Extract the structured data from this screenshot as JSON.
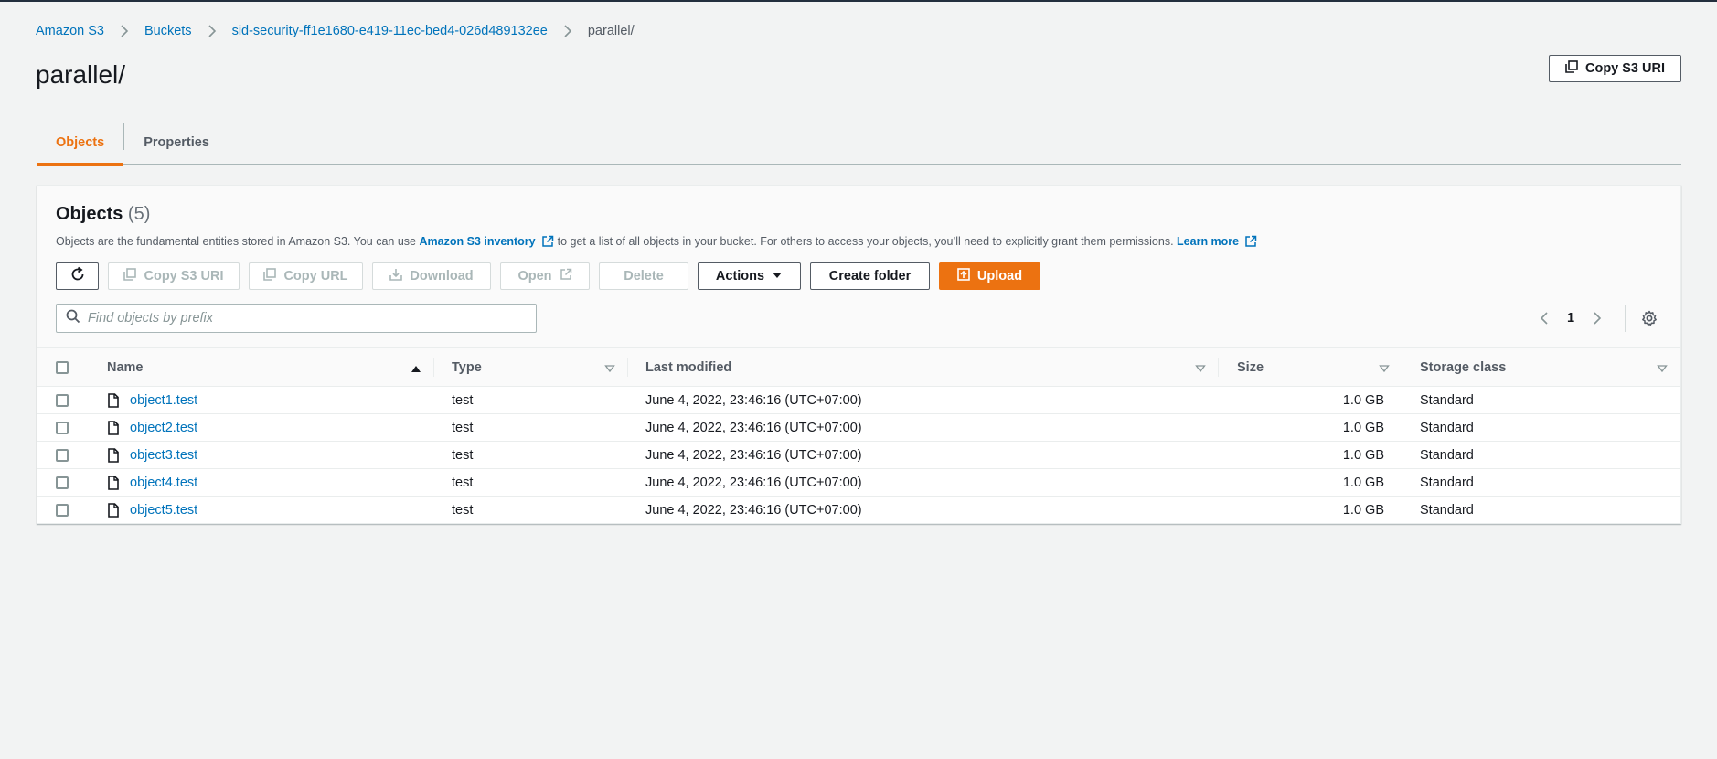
{
  "breadcrumb": {
    "items": [
      "Amazon S3",
      "Buckets",
      "sid-security-ff1e1680-e419-11ec-bed4-026d489132ee"
    ],
    "current": "parallel/"
  },
  "page": {
    "title": "parallel/",
    "copy_uri_label": "Copy S3 URI"
  },
  "tabs": [
    {
      "label": "Objects",
      "active": true
    },
    {
      "label": "Properties",
      "active": false
    }
  ],
  "objects_panel": {
    "title": "Objects",
    "count": "(5)",
    "desc_part1": "Objects are the fundamental entities stored in Amazon S3. You can use",
    "desc_link1": "Amazon S3 inventory",
    "desc_part2": "to get a list of all objects in your bucket. For others to access your objects, you’ll need to explicitly grant them permissions.",
    "desc_link2": "Learn more"
  },
  "toolbar": {
    "copy_s3_uri": "Copy S3 URI",
    "copy_url": "Copy URL",
    "download": "Download",
    "open": "Open",
    "delete": "Delete",
    "actions": "Actions",
    "create_folder": "Create folder",
    "upload": "Upload"
  },
  "search": {
    "placeholder": "Find objects by prefix",
    "value": ""
  },
  "pagination": {
    "page": "1"
  },
  "table": {
    "columns": [
      "Name",
      "Type",
      "Last modified",
      "Size",
      "Storage class"
    ],
    "rows": [
      {
        "name": "object1.test",
        "type": "test",
        "modified": "June 4, 2022, 23:46:16 (UTC+07:00)",
        "size": "1.0 GB",
        "storage": "Standard"
      },
      {
        "name": "object2.test",
        "type": "test",
        "modified": "June 4, 2022, 23:46:16 (UTC+07:00)",
        "size": "1.0 GB",
        "storage": "Standard"
      },
      {
        "name": "object3.test",
        "type": "test",
        "modified": "June 4, 2022, 23:46:16 (UTC+07:00)",
        "size": "1.0 GB",
        "storage": "Standard"
      },
      {
        "name": "object4.test",
        "type": "test",
        "modified": "June 4, 2022, 23:46:16 (UTC+07:00)",
        "size": "1.0 GB",
        "storage": "Standard"
      },
      {
        "name": "object5.test",
        "type": "test",
        "modified": "June 4, 2022, 23:46:16 (UTC+07:00)",
        "size": "1.0 GB",
        "storage": "Standard"
      }
    ]
  },
  "colors": {
    "accent": "#ec7211",
    "link": "#0073bb",
    "header_bar": "#232f3e"
  },
  "icons": [
    "chevron-right-icon",
    "copy-icon",
    "refresh-icon",
    "download-icon",
    "external-link-icon",
    "caret-down-icon",
    "upload-icon",
    "search-icon",
    "chevron-left-icon",
    "gear-icon",
    "sort-asc-icon",
    "sort-icon",
    "file-icon"
  ]
}
